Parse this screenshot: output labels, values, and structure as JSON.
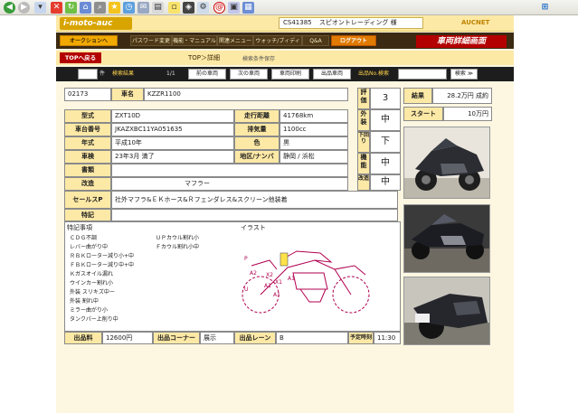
{
  "browser": {
    "icons": [
      "back-icon",
      "forward-icon",
      "stop-icon",
      "refresh-icon",
      "home-icon",
      "search-icon",
      "favorites-icon",
      "history-icon",
      "mail-icon",
      "print-icon",
      "edit-icon"
    ],
    "windows_logo": "windows-logo-icon"
  },
  "header": {
    "logo": "i-moto-auc",
    "user_code": "CS41385",
    "user_name": "スピオントレーディング 様",
    "auc_logo": "AUCNET",
    "banner": "車両詳細画面"
  },
  "menu": {
    "items": [
      "オークションへ",
      "パスワード変更",
      "機能・マニュアル",
      "関連メニュー",
      "ウォッチ/ブィディア",
      "Q&A",
      "ログアウト"
    ]
  },
  "subheader": {
    "top_button": "TOPへ戻る",
    "title": "TOP＞詳細",
    "note": "検索条件保存"
  },
  "nav": {
    "count_label": "件",
    "search_result": "検索結果",
    "page": "1/1",
    "prev": "前の車両",
    "next": "次の車両",
    "print": "車両印刷",
    "watch": "出品車両",
    "entry_no_label": "出品No.検索",
    "search_button": "検索 ≫"
  },
  "vehicle": {
    "lot_no": "02173",
    "model_label": "車名",
    "model": "KZZR1100",
    "type_label": "型式",
    "type": "ZXT10D",
    "mileage_label": "走行距離",
    "mileage": "41768km",
    "frame_label": "車台番号",
    "frame": "JKAZXBC11YA051635",
    "displacement_label": "排気量",
    "displacement": "1100cc",
    "year_label": "年式",
    "year": "平成10年",
    "color_label": "色",
    "color": "黒",
    "inspection_label": "車検",
    "inspection": "23年3月 満了",
    "region_label": "地区/ナンバ",
    "region": "静岡 / 浜松",
    "docs_label": "書類",
    "docs": "",
    "modify_label": "改造",
    "modify": "マフラー",
    "selling_label": "セールスP",
    "selling": "社外マフラ&ＥＫホース&Ｒフェンダレス&スクリーン他装着",
    "note_label": "特記",
    "note": ""
  },
  "scores": {
    "eval_label": "評価",
    "eval": "3",
    "exterior_label": "外装",
    "exterior": "中",
    "frame_label": "下回り",
    "frame": "下",
    "engine_label": "機能",
    "engine": "中",
    "modify_label": "改造",
    "modify": "中"
  },
  "result": {
    "result_label": "結果",
    "result": "28.2万円 成約",
    "start_label": "スタート",
    "start": "10万円"
  },
  "remarks": {
    "header": "特記事項",
    "illust_header": "イラスト",
    "left": [
      "ＣＤＧ不調",
      "レバー曲がり中",
      "ＲＢＫローター減り小+中",
      "ＦＢＫローター減り中+中",
      "Ｋガスオイル漏れ",
      "ウインカー割れ小",
      "外装 スリキズ中ー",
      "外装 割れ中",
      "ミラー曲がり小",
      "タンクパー上削り中"
    ],
    "right": [
      "ＵＰカウル割れ小",
      "Ｆカウル割れ小中"
    ]
  },
  "footer": {
    "fee_label": "出品料",
    "fee": "12600円",
    "corner_label": "出品コーナー",
    "corner": "展示",
    "lane_label": "出品レーン",
    "lane": "B",
    "time_label": "予定時刻",
    "time": "11:30"
  }
}
